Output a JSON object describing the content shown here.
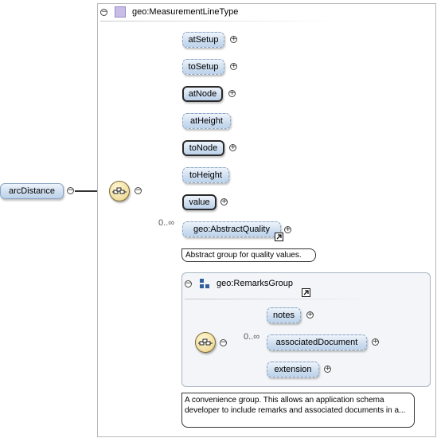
{
  "type_box": {
    "title": "geo:MeasurementLineType"
  },
  "root_element": {
    "label": "arcDistance"
  },
  "children": [
    {
      "label": "atSetup",
      "required": false
    },
    {
      "label": "toSetup",
      "required": false
    },
    {
      "label": "atNode",
      "required": true
    },
    {
      "label": "atHeight",
      "required": false
    },
    {
      "label": "toNode",
      "required": true
    },
    {
      "label": "toHeight",
      "required": false
    },
    {
      "label": "value",
      "required": true
    },
    {
      "label": "geo:AbstractQuality",
      "cardinality": "0..∞",
      "note": "Abstract group for quality values."
    }
  ],
  "remarks_group": {
    "title": "geo:RemarksGroup",
    "items": [
      {
        "label": "notes"
      },
      {
        "label": "associatedDocument",
        "cardinality": "0..∞"
      },
      {
        "label": "extension"
      }
    ],
    "note": "A convenience group. This allows an application schema developer to include remarks and associated documents in a..."
  },
  "colors": {
    "node_fill": "#cfdff0",
    "node_border": "#8ca5c4",
    "sequence_fill": "#f1dc9c",
    "type_icon": "#c8bde6",
    "group_icon": "#2f5f9e"
  },
  "icons": {
    "collapse": "minus-circle-icon",
    "expand": "plus-circle-icon",
    "sequence": "sequence-compositor-icon",
    "reference": "reference-arrow-icon"
  }
}
